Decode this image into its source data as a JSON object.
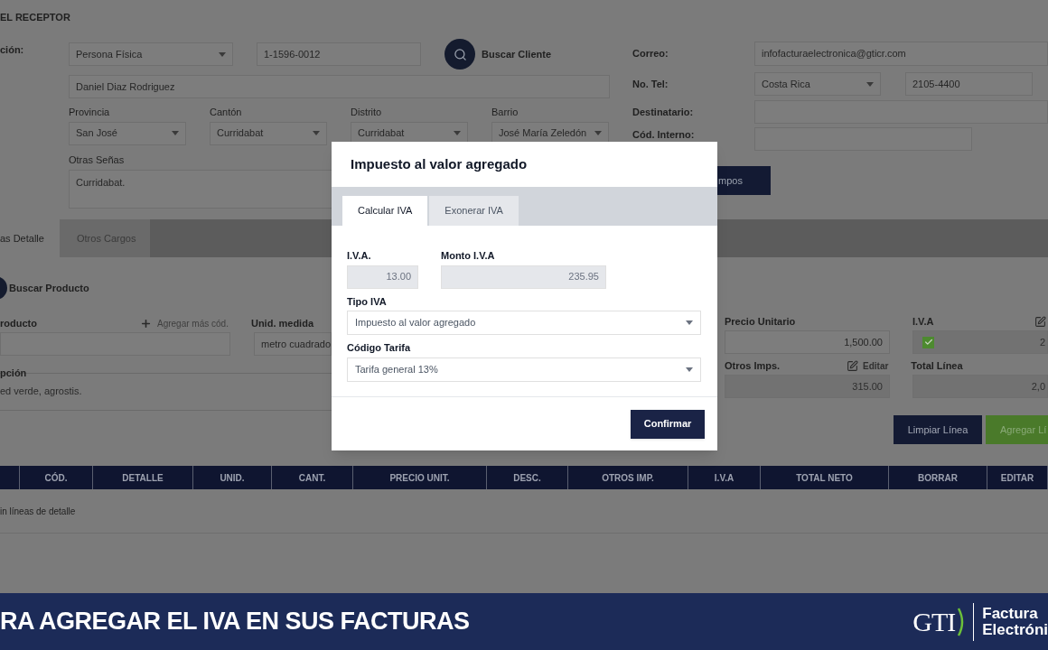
{
  "receptor": {
    "section_title": "EL RECEPTOR",
    "id_label": "ción:",
    "id_type": "Persona Física",
    "id_number": "1-1596-0012",
    "search_button": "Buscar Cliente",
    "name": "Daniel Diaz Rodriguez",
    "location": [
      {
        "label": "Provincia",
        "value": "San José"
      },
      {
        "label": "Cantón",
        "value": "Curridabat"
      },
      {
        "label": "Distrito",
        "value": "Curridabat"
      },
      {
        "label": "Barrio",
        "value": "José María Zeledón"
      }
    ],
    "other_label": "Otras Señas",
    "other_value": "Curridabat.",
    "contact": {
      "email_label": "Correo:",
      "email": "infofacturaelectronica@gticr.com",
      "phone_label": "No. Tel:",
      "country": "Costa Rica",
      "phone": "2105-4400",
      "recipient_label": "Destinatario:",
      "internal_code_label": "Cód. Interno:"
    },
    "partial_button": "mpos"
  },
  "detail_tabs": [
    {
      "label": "as Detalle",
      "selected": true
    },
    {
      "label": "Otros Cargos",
      "selected": false
    }
  ],
  "product": {
    "search_button": "Buscar Producto",
    "code_label": "roducto",
    "add_code": "Agregar más cód.",
    "unit_label": "Unid. medida",
    "unit": "metro cuadrado",
    "description_label": "pción",
    "description": "ed verde, agrostis.",
    "price_label": "Precio Unitario",
    "price": "1,500.00",
    "iva_label": "I.V.A",
    "iva_checked": true,
    "iva_value": "2",
    "other_taxes_label": "Otros Imps.",
    "edit_link": "Editar",
    "other_taxes": "315.00",
    "total_label": "Total Línea",
    "total": "2,0",
    "clear_button": "Limpiar Línea",
    "add_button": "Agregar Lí"
  },
  "table": {
    "columns": [
      "CÓD.",
      "DETALLE",
      "UNID.",
      "CANT.",
      "PRECIO UNIT.",
      "DESC.",
      "OTROS IMP.",
      "I.V.A",
      "TOTAL NETO",
      "BORRAR",
      "EDITAR"
    ],
    "empty_message": "in líneas de detalle"
  },
  "modal": {
    "title": "Impuesto al valor agregado",
    "tabs": [
      {
        "label": "Calcular IVA",
        "selected": true
      },
      {
        "label": "Exonerar IVA",
        "selected": false
      }
    ],
    "iva_label": "I.V.A.",
    "iva": "13.00",
    "amount_label": "Monto I.V.A",
    "amount": "235.95",
    "type_label": "Tipo IVA",
    "type": "Impuesto al valor agregado",
    "rate_label": "Código Tarifa",
    "rate": "Tarifa general 13%",
    "confirm_button": "Confirmar"
  },
  "banner": {
    "text": "RA AGREGAR EL IVA EN SUS FACTURAS",
    "logo": "GTI",
    "brand_lines": [
      "Factura",
      "Electróni"
    ]
  }
}
